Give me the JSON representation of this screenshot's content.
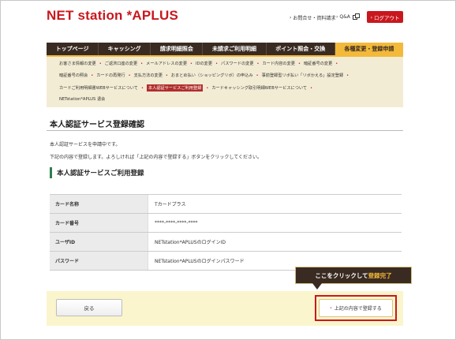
{
  "header": {
    "logo": "NET station *APLUS",
    "links": [
      {
        "label": "お問合せ・資料請求"
      },
      {
        "label": "Q&A"
      }
    ],
    "logout_label": "ログアウト"
  },
  "nav": {
    "items": [
      {
        "label": "トップページ"
      },
      {
        "label": "キャッシング"
      },
      {
        "label": "請求明細照会"
      },
      {
        "label": "未請求ご利用明細"
      },
      {
        "label": "ポイント照会・交換"
      },
      {
        "label": "各種変更・登録申請"
      }
    ],
    "active_index": 5
  },
  "subnav": {
    "rows": [
      [
        "お客さま情報の変更",
        "ご返済口座の変更",
        "メールアドレスの変更",
        "IDの変更",
        "パスワードの変更",
        "カード内容の変更",
        "暗証番号の変更"
      ],
      [
        "暗証番号の照会",
        "カードの再発行",
        "支払方法の変更",
        "おまとめ払い（ショッピングリボ）の申込み",
        "事前登録型リボ払い「リボかえる」設定登録"
      ],
      [
        "カードご利用明細書WEBサービスについて",
        "本人認証サービスご利用登録",
        "カードキャッシング取引明細WEBサービスについて"
      ],
      [
        "NETstation*APLUS 退会"
      ]
    ],
    "active_label": "本人認証サービスご利用登録"
  },
  "main": {
    "page_title": "本人認証サービス登録確認",
    "paragraph_1": "本人認証サービスを申請中です。",
    "paragraph_2": "下記の内容で登録します。よろしければ「上記の内容で登録する」ボタンをクリックしてください。",
    "section_heading": "本人認証サービスご利用登録",
    "table": [
      {
        "label": "カード名称",
        "value": "Tカードプラス"
      },
      {
        "label": "カード番号",
        "value": "****-****-****-****"
      },
      {
        "label": "ユーザID",
        "value": "NETstation*APLUSのログインID"
      },
      {
        "label": "パスワード",
        "value": "NETstation*APLUSのログインパスワード"
      }
    ]
  },
  "actions": {
    "back_label": "戻る",
    "submit_label": "上記の内容で登録する"
  },
  "callout": {
    "text_prefix": "ここをクリックして",
    "text_highlight": "登録完了"
  },
  "colors": {
    "brand_red": "#c8181e",
    "nav_brown": "#3a2b22",
    "accent_yellow": "#f3b93a",
    "subnav_bg": "#f3ecd4",
    "action_bg": "#fbf5cd",
    "heading_green": "#2e7d4f"
  }
}
